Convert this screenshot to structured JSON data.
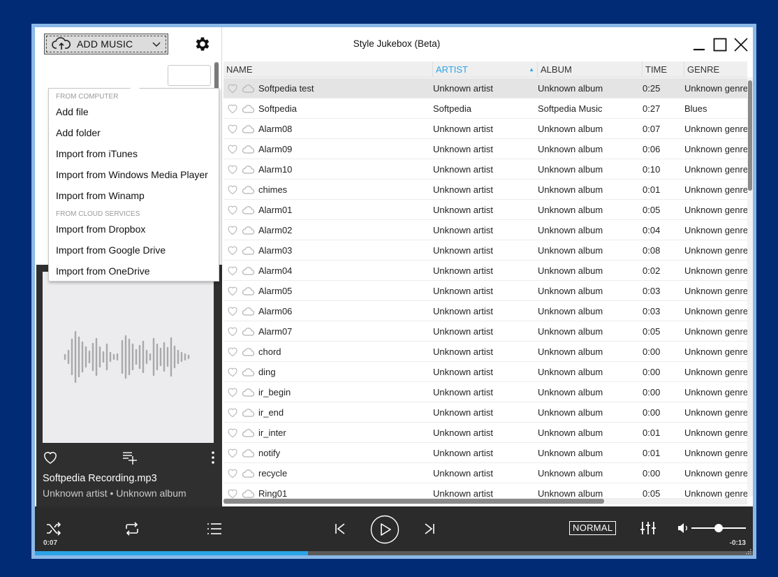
{
  "window": {
    "title": "Style Jukebox (Beta)"
  },
  "left_panel": {
    "add_music_label": "ADD MUSIC"
  },
  "menu": {
    "section_computer": "FROM COMPUTER",
    "computer_items": [
      "Add file",
      "Add folder",
      "Import from iTunes",
      "Import from Windows Media Player",
      "Import from Winamp"
    ],
    "section_cloud": "FROM CLOUD SERVICES",
    "cloud_items": [
      "Import from Dropbox",
      "Import from Google Drive",
      "Import from OneDrive"
    ]
  },
  "now_playing": {
    "track_name": "Softpedia Recording.mp3",
    "track_sub": "Unknown artist • Unknown album"
  },
  "table": {
    "columns": [
      "NAME",
      "ARTIST",
      "ALBUM",
      "TIME",
      "GENRE"
    ],
    "sorted_column": "ARTIST",
    "rows": [
      [
        "Softpedia test",
        "Unknown artist",
        "Unknown album",
        "0:25",
        "Unknown genre"
      ],
      [
        "Softpedia",
        "Softpedia",
        "Softpedia Music",
        "0:27",
        "Blues"
      ],
      [
        "Alarm08",
        "Unknown artist",
        "Unknown album",
        "0:07",
        "Unknown genre"
      ],
      [
        "Alarm09",
        "Unknown artist",
        "Unknown album",
        "0:06",
        "Unknown genre"
      ],
      [
        "Alarm10",
        "Unknown artist",
        "Unknown album",
        "0:10",
        "Unknown genre"
      ],
      [
        "chimes",
        "Unknown artist",
        "Unknown album",
        "0:01",
        "Unknown genre"
      ],
      [
        "Alarm01",
        "Unknown artist",
        "Unknown album",
        "0:05",
        "Unknown genre"
      ],
      [
        "Alarm02",
        "Unknown artist",
        "Unknown album",
        "0:04",
        "Unknown genre"
      ],
      [
        "Alarm03",
        "Unknown artist",
        "Unknown album",
        "0:08",
        "Unknown genre"
      ],
      [
        "Alarm04",
        "Unknown artist",
        "Unknown album",
        "0:02",
        "Unknown genre"
      ],
      [
        "Alarm05",
        "Unknown artist",
        "Unknown album",
        "0:03",
        "Unknown genre"
      ],
      [
        "Alarm06",
        "Unknown artist",
        "Unknown album",
        "0:03",
        "Unknown genre"
      ],
      [
        "Alarm07",
        "Unknown artist",
        "Unknown album",
        "0:05",
        "Unknown genre"
      ],
      [
        "chord",
        "Unknown artist",
        "Unknown album",
        "0:00",
        "Unknown genre"
      ],
      [
        "ding",
        "Unknown artist",
        "Unknown album",
        "0:00",
        "Unknown genre"
      ],
      [
        "ir_begin",
        "Unknown artist",
        "Unknown album",
        "0:00",
        "Unknown genre"
      ],
      [
        "ir_end",
        "Unknown artist",
        "Unknown album",
        "0:00",
        "Unknown genre"
      ],
      [
        "ir_inter",
        "Unknown artist",
        "Unknown album",
        "0:01",
        "Unknown genre"
      ],
      [
        "notify",
        "Unknown artist",
        "Unknown album",
        "0:01",
        "Unknown genre"
      ],
      [
        "recycle",
        "Unknown artist",
        "Unknown album",
        "0:00",
        "Unknown genre"
      ],
      [
        "Ring01",
        "Unknown artist",
        "Unknown album",
        "0:05",
        "Unknown genre"
      ]
    ],
    "selected_row": 0
  },
  "controls": {
    "elapsed": "0:07",
    "remaining": "-0:13",
    "playback_mode": "NORMAL",
    "progress_fraction": 0.38,
    "volume_fraction": 0.5
  },
  "colors": {
    "accent": "#2ca3e6",
    "background": "#022b75",
    "window_border": "#8ab9e8",
    "control_bar": "#2b2b2b"
  },
  "icons": [
    "cloud-upload-icon",
    "chevron-down-icon",
    "gear-icon",
    "heart-icon",
    "cloud-icon",
    "add-to-queue-icon",
    "more-icon",
    "shuffle-icon",
    "repeat-icon",
    "playlist-icon",
    "previous-icon",
    "play-icon",
    "next-icon",
    "equalizer-icon",
    "volume-icon",
    "minimize-icon",
    "maximize-icon",
    "close-icon"
  ]
}
